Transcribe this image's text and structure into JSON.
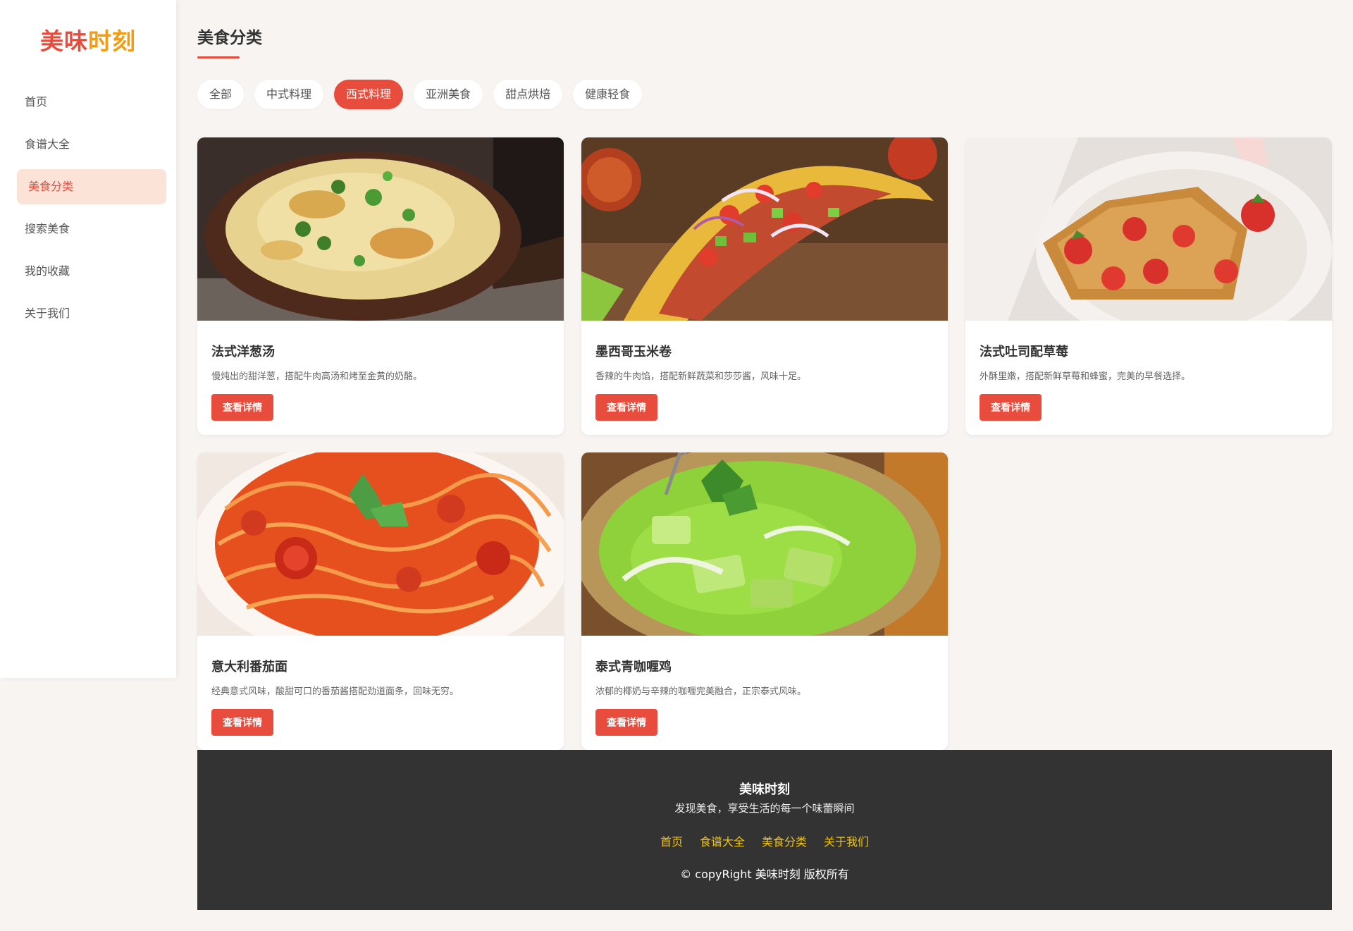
{
  "brand": {
    "part1": "美味",
    "part2": "时刻",
    "color1": "#e74c3c",
    "color2": "#f39c12"
  },
  "nav": {
    "items": [
      {
        "label": "首页",
        "active": false
      },
      {
        "label": "食谱大全",
        "active": false
      },
      {
        "label": "美食分类",
        "active": true
      },
      {
        "label": "搜索美食",
        "active": false
      },
      {
        "label": "我的收藏",
        "active": false
      },
      {
        "label": "关于我们",
        "active": false
      }
    ]
  },
  "page": {
    "title": "美食分类"
  },
  "filters": {
    "items": [
      "全部",
      "中式料理",
      "西式料理",
      "亚洲美食",
      "甜点烘焙",
      "健康轻食"
    ],
    "active": "西式料理"
  },
  "cards": [
    {
      "title": "法式洋葱汤",
      "desc": "慢炖出的甜洋葱，搭配牛肉高汤和烤至金黄的奶酪。",
      "button": "查看详情",
      "image": "french-onion-soup"
    },
    {
      "title": "墨西哥玉米卷",
      "desc": "香辣的牛肉馅，搭配新鲜蔬菜和莎莎酱，风味十足。",
      "button": "查看详情",
      "image": "tacos"
    },
    {
      "title": "法式吐司配草莓",
      "desc": "外酥里嫩，搭配新鲜草莓和蜂蜜，完美的早餐选择。",
      "button": "查看详情",
      "image": "french-toast-strawberries"
    },
    {
      "title": "意大利番茄面",
      "desc": "经典意式风味，酸甜可口的番茄酱搭配劲道面条，回味无穷。",
      "button": "查看详情",
      "image": "tomato-spaghetti"
    },
    {
      "title": "泰式青咖喱鸡",
      "desc": "浓郁的椰奶与辛辣的咖喱完美融合，正宗泰式风味。",
      "button": "查看详情",
      "image": "thai-green-curry"
    }
  ],
  "footer": {
    "brand": "美味时刻",
    "slogan": "发现美食，享受生活的每一个味蕾瞬间",
    "links": [
      "首页",
      "食谱大全",
      "美食分类",
      "关于我们"
    ],
    "copyright": "© copyRight 美味时刻 版权所有"
  },
  "colors": {
    "accent": "#e74c3c",
    "active_nav_bg": "#fbe3d8",
    "footer_bg": "#333333",
    "footer_link": "#f1c40f"
  }
}
